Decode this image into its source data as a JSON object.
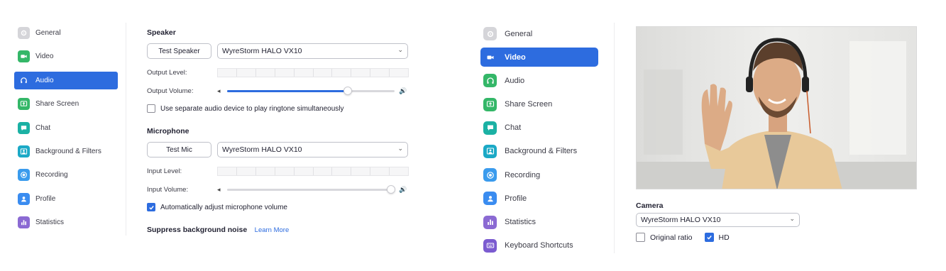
{
  "nav_items": [
    {
      "label": "General",
      "icon": "gear-icon"
    },
    {
      "label": "Video",
      "icon": "video-camera-icon"
    },
    {
      "label": "Audio",
      "icon": "headphones-icon"
    },
    {
      "label": "Share Screen",
      "icon": "share-screen-icon"
    },
    {
      "label": "Chat",
      "icon": "chat-icon"
    },
    {
      "label": "Background & Filters",
      "icon": "background-icon"
    },
    {
      "label": "Recording",
      "icon": "recording-icon"
    },
    {
      "label": "Profile",
      "icon": "profile-icon"
    },
    {
      "label": "Statistics",
      "icon": "statistics-icon"
    },
    {
      "label": "Keyboard Shortcuts",
      "icon": "keyboard-icon"
    }
  ],
  "left_panel": {
    "active": "Audio"
  },
  "audio": {
    "speaker": {
      "title": "Speaker",
      "test_label": "Test Speaker",
      "device": "WyreStorm HALO VX10",
      "output_level_label": "Output Level:",
      "output_volume_label": "Output Volume:",
      "output_volume_fraction": 0.72
    },
    "ringtone_checkbox": {
      "label": "Use separate audio device to play ringtone simultaneously",
      "checked": false
    },
    "microphone": {
      "title": "Microphone",
      "test_label": "Test Mic",
      "device": "WyreStorm HALO VX10",
      "input_level_label": "Input Level:",
      "input_volume_label": "Input Volume:",
      "input_volume_fraction": 0.98
    },
    "auto_adjust_checkbox": {
      "label": "Automatically adjust microphone volume",
      "checked": true
    },
    "suppress": {
      "title": "Suppress background noise",
      "link": "Learn More"
    }
  },
  "right_panel": {
    "active": "Video"
  },
  "video": {
    "camera_title": "Camera",
    "camera_device": "WyreStorm HALO VX10",
    "original_ratio": {
      "label": "Original ratio",
      "checked": false
    },
    "hd": {
      "label": "HD",
      "checked": true
    }
  },
  "colors": {
    "accent": "#2d6cdf",
    "gear": "#c7c7cc",
    "video": "#34b768",
    "audio": "#34b768",
    "share": "#34b768",
    "chat": "#1bb1a4",
    "background": "#1ba9c6",
    "recording": "#3a9bed",
    "profile": "#3a8cf0",
    "statistics": "#8b6ad3",
    "keyboard": "#7b5bd0"
  }
}
